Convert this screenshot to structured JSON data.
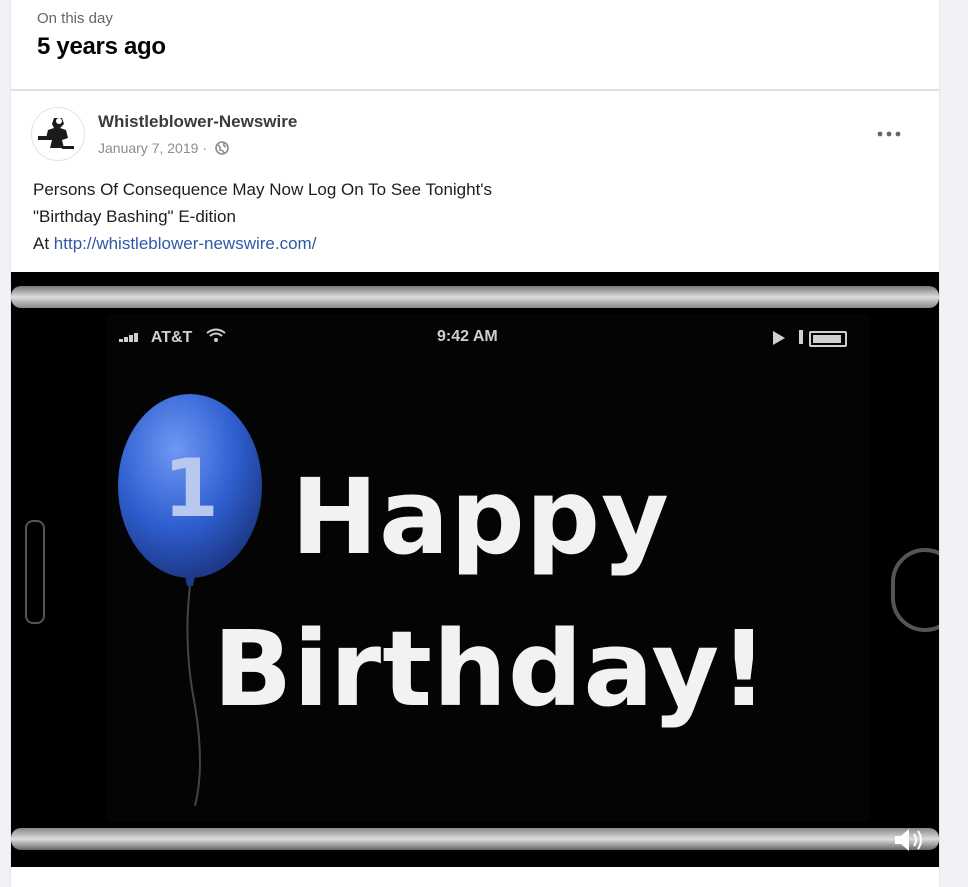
{
  "memory": {
    "label": "On this day",
    "years_ago": "5 years ago"
  },
  "post": {
    "author": "Whistleblower-Newswire",
    "date": "January 7, 2019",
    "separator": "·",
    "privacy_icon": "globe-icon",
    "menu_icon": "more-options-icon",
    "text_line1": "Persons Of Consequence May Now Log On To See Tonight's",
    "text_line2": "\"Birthday Bashing\" E-dition",
    "text_line3_prefix": "At ",
    "link": "http://whistleblower-newswire.com/"
  },
  "video": {
    "carrier": "AT&T",
    "time": "9:42 AM",
    "balloon_number": "1",
    "line1": "Happy",
    "line2": "Birthday!",
    "volume_icon": "volume-icon"
  },
  "colors": {
    "link": "#2e59a8",
    "balloon": "#2f5fd0"
  }
}
